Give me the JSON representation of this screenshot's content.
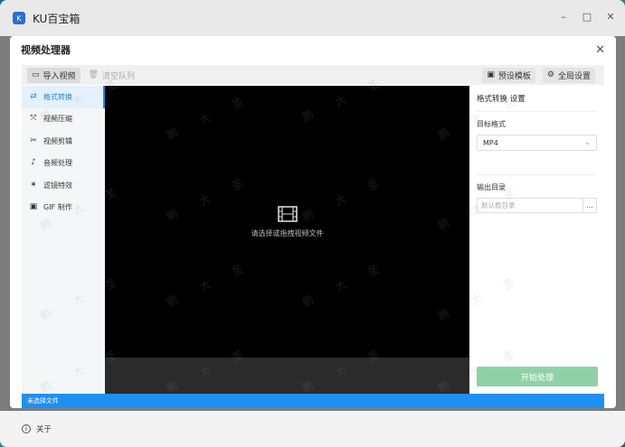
{
  "app": {
    "title": "KU百宝箱",
    "logo_glyph": "K",
    "minimize": "–",
    "maximize": "□",
    "close": "✕"
  },
  "dialog": {
    "title": "视频处理器",
    "close": "✕"
  },
  "toolbar": {
    "import_label": "导入视频",
    "clear_label": "清空队列",
    "preset_label": "预设模板",
    "global_label": "全局设置"
  },
  "sidebar": {
    "items": [
      {
        "label": "格式转换",
        "icon": "⇄",
        "active": true
      },
      {
        "label": "视频压缩",
        "icon": "⤧",
        "active": false
      },
      {
        "label": "视频剪辑",
        "icon": "✂",
        "active": false
      },
      {
        "label": "音频处理",
        "icon": "♪",
        "active": false
      },
      {
        "label": "滤镜特效",
        "icon": "✶",
        "active": false
      },
      {
        "label": "GIF 制作",
        "icon": "▣",
        "active": false
      }
    ]
  },
  "preview": {
    "hint": "请选择或拖拽视频文件"
  },
  "settings": {
    "title": "格式转换 设置",
    "target_format_label": "目标格式",
    "target_format_value": "MP4",
    "output_dir_label": "输出目录",
    "output_dir_placeholder": "默认原目录",
    "browse_label": "...",
    "start_label": "开始处理"
  },
  "status": {
    "text": "未选择文件"
  },
  "footer": {
    "about_label": "关于"
  },
  "watermark": {
    "text": "鹏 大 圣"
  },
  "colors": {
    "accent": "#1e90f2",
    "start_button": "#8fd2a8",
    "preview_bg": "#000000"
  }
}
